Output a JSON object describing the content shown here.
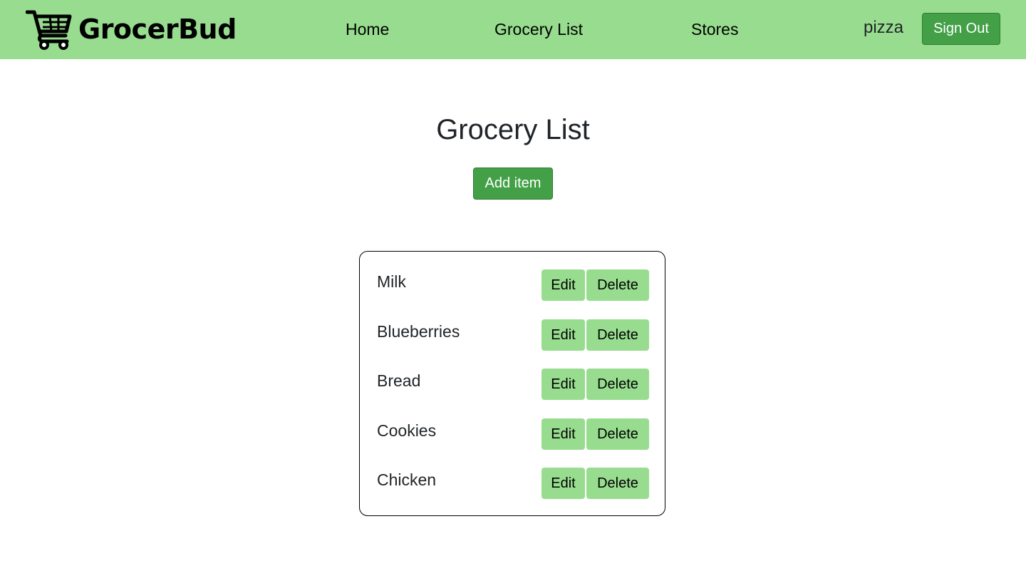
{
  "navbar": {
    "brand": "GrocerBud",
    "links": [
      "Home",
      "Grocery List",
      "Stores"
    ],
    "username": "pizza",
    "sign_out_label": "Sign Out"
  },
  "main": {
    "title": "Grocery List",
    "add_item_label": "Add item",
    "items": [
      {
        "name": "Milk",
        "edit_label": "Edit",
        "delete_label": "Delete"
      },
      {
        "name": "Blueberries",
        "edit_label": "Edit",
        "delete_label": "Delete"
      },
      {
        "name": "Bread",
        "edit_label": "Edit",
        "delete_label": "Delete"
      },
      {
        "name": "Cookies",
        "edit_label": "Edit",
        "delete_label": "Delete"
      },
      {
        "name": "Chicken",
        "edit_label": "Edit",
        "delete_label": "Delete"
      }
    ]
  },
  "icons": {
    "brand_icon": "shopping-cart-icon"
  },
  "colors": {
    "navbar_bg": "#98dd8f",
    "primary_button": "#43a047",
    "item_button": "#98dd8f"
  }
}
